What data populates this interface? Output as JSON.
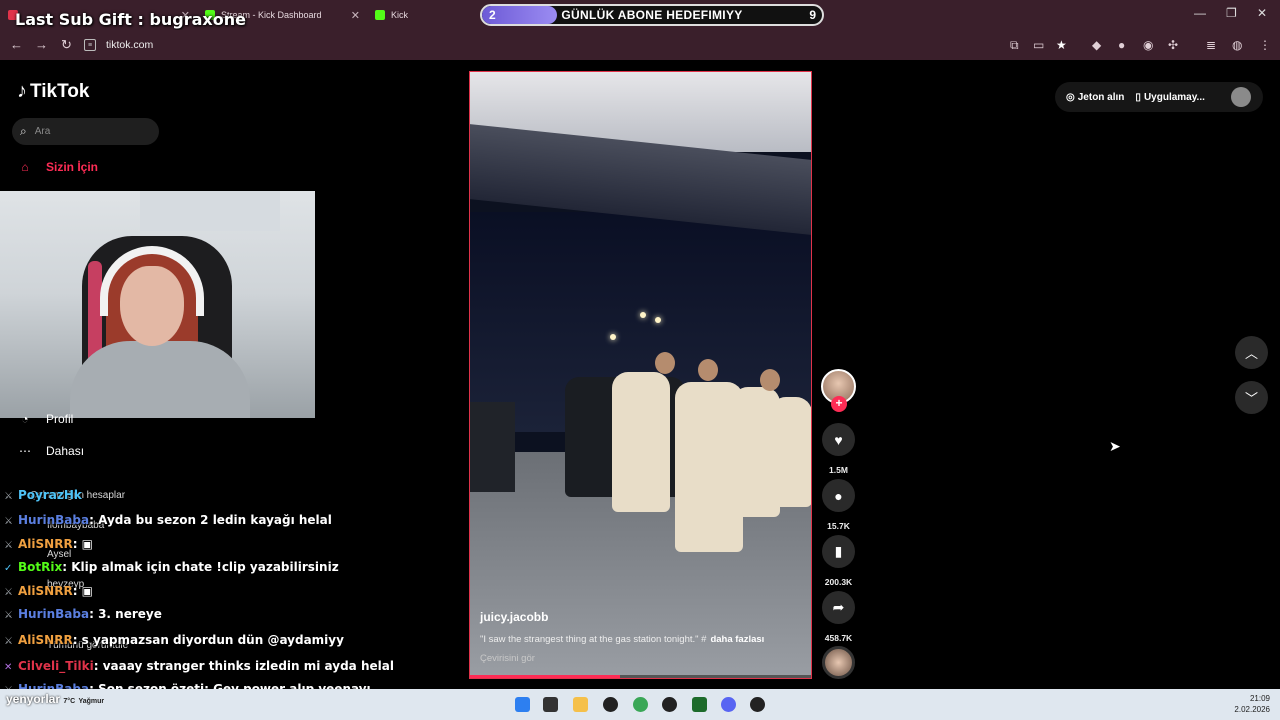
{
  "browser": {
    "tabs": [
      {
        "label": "",
        "color": "#e0334a"
      },
      {
        "label": "Stream - Kick Dashboard",
        "color": "#53fc18"
      },
      {
        "label": "Kick",
        "color": "#53fc18"
      }
    ],
    "url": "tiktok.com"
  },
  "overlay": {
    "last_sub_gift": "Last Sub Gift : bugraxone",
    "goal": {
      "current": "2",
      "title": "GÜNLÜK ABONE HEDEFIMIYY",
      "target": "9",
      "progress": 0.22
    }
  },
  "tiktok": {
    "brand": "TikTok",
    "search_placeholder": "Ara",
    "nav": {
      "for_you": "Sizin İçin",
      "profile": "Profil",
      "more": "Dahası"
    },
    "top_actions": {
      "coins": "Jeton alın",
      "app": "Uygulamay..."
    },
    "video": {
      "author": "juicy.jacobb",
      "caption": "\"I saw the strangest thing at the gas station tonight.\" #",
      "more": "daha fazlası",
      "translate": "Çevirisini gör",
      "progress": 0.44
    },
    "stats": {
      "likes": "1.5M",
      "comments": "15.7K",
      "saves": "200.3K",
      "shares": "458.7K"
    }
  },
  "chat": [
    {
      "user": "PoyrazHk",
      "color": "#4fc3f7",
      "text": ""
    },
    {
      "user": "HurinBaba",
      "color": "#5b7fe0",
      "text": "Ayda bu sezon 2 ledin kayağı helal"
    },
    {
      "user": "AliSNRR",
      "color": "#f0a040",
      "text": ""
    },
    {
      "user": "BotRix",
      "color": "#53fc18",
      "text": "Klip almak için chate !clip yazabilirsiniz"
    },
    {
      "user": "AliSNRR",
      "color": "#f0a040",
      "text": ""
    },
    {
      "user": "HurinBaba",
      "color": "#5b7fe0",
      "text": "3. nereye"
    },
    {
      "user": "AliSNRR",
      "color": "#f0a040",
      "text": "s yapmazsan diyordun dün @aydamiyy"
    },
    {
      "user": "Cilveli_Tilki",
      "color": "#e0334a",
      "text": "vaaay stranger thinks izledin mi ayda helal"
    },
    {
      "user": "HurinBaba",
      "color": "#5b7fe0",
      "text": "Son sezon özeti: Gey power alıp veenayı"
    }
  ],
  "ghost_text": {
    "a": "Çalmadığım hesaplar",
    "b": "flombaybaba",
    "c": "Aysel",
    "d": "beyzeyp",
    "e": "Tümünü görüntüle"
  },
  "taskbar": {
    "weather_text": "yenyorlar",
    "temp": "7°C",
    "condition": "Yağmur",
    "time": "21:09",
    "date": "2.02.2026"
  }
}
